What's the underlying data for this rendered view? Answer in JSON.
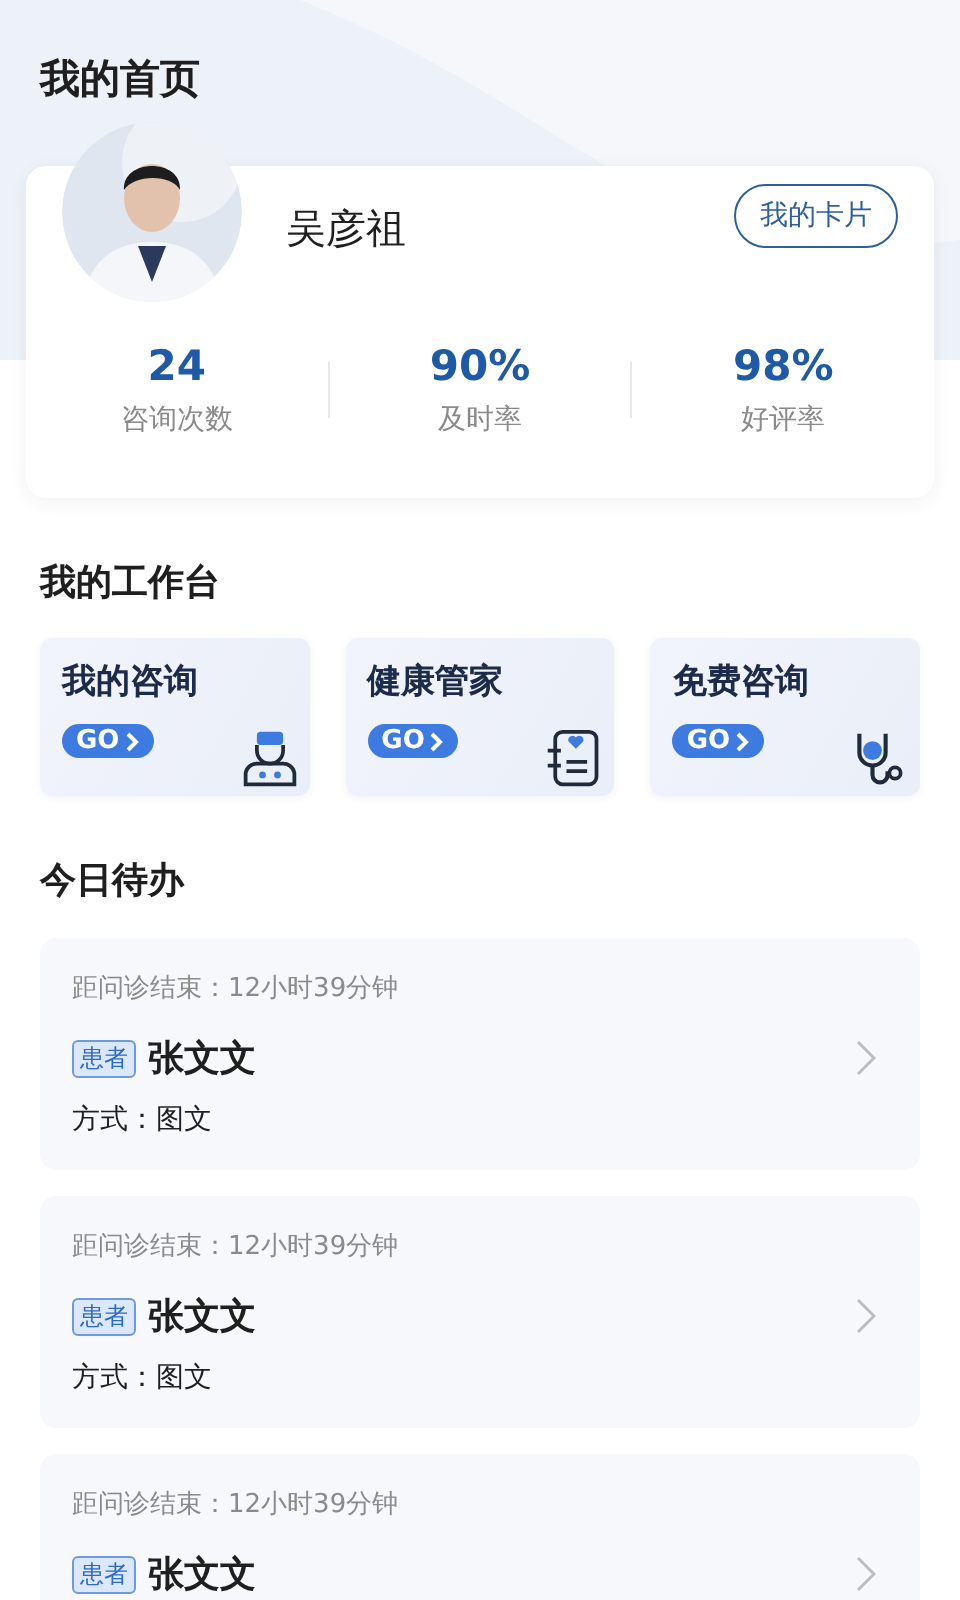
{
  "page_title": "我的首页",
  "profile": {
    "name": "吴彦祖",
    "card_button": "我的卡片",
    "stats": [
      {
        "value": "24",
        "label": "咨询次数"
      },
      {
        "value": "90%",
        "label": "及时率"
      },
      {
        "value": "98%",
        "label": "好评率"
      }
    ]
  },
  "workbench": {
    "title": "我的工作台",
    "tiles": [
      {
        "label": "我的咨询",
        "go": "GO",
        "kind": "doctor"
      },
      {
        "label": "健康管家",
        "go": "GO",
        "kind": "record"
      },
      {
        "label": "免费咨询",
        "go": "GO",
        "kind": "stethoscope"
      }
    ]
  },
  "todo": {
    "title": "今日待办",
    "items": [
      {
        "countdown": "距问诊结束：12小时39分钟",
        "tag": "患者",
        "patient": "张文文",
        "method": "方式：图文"
      },
      {
        "countdown": "距问诊结束：12小时39分钟",
        "tag": "患者",
        "patient": "张文文",
        "method": "方式：图文"
      },
      {
        "countdown": "距问诊结束：12小时39分钟",
        "tag": "患者",
        "patient": "张文文"
      }
    ]
  }
}
